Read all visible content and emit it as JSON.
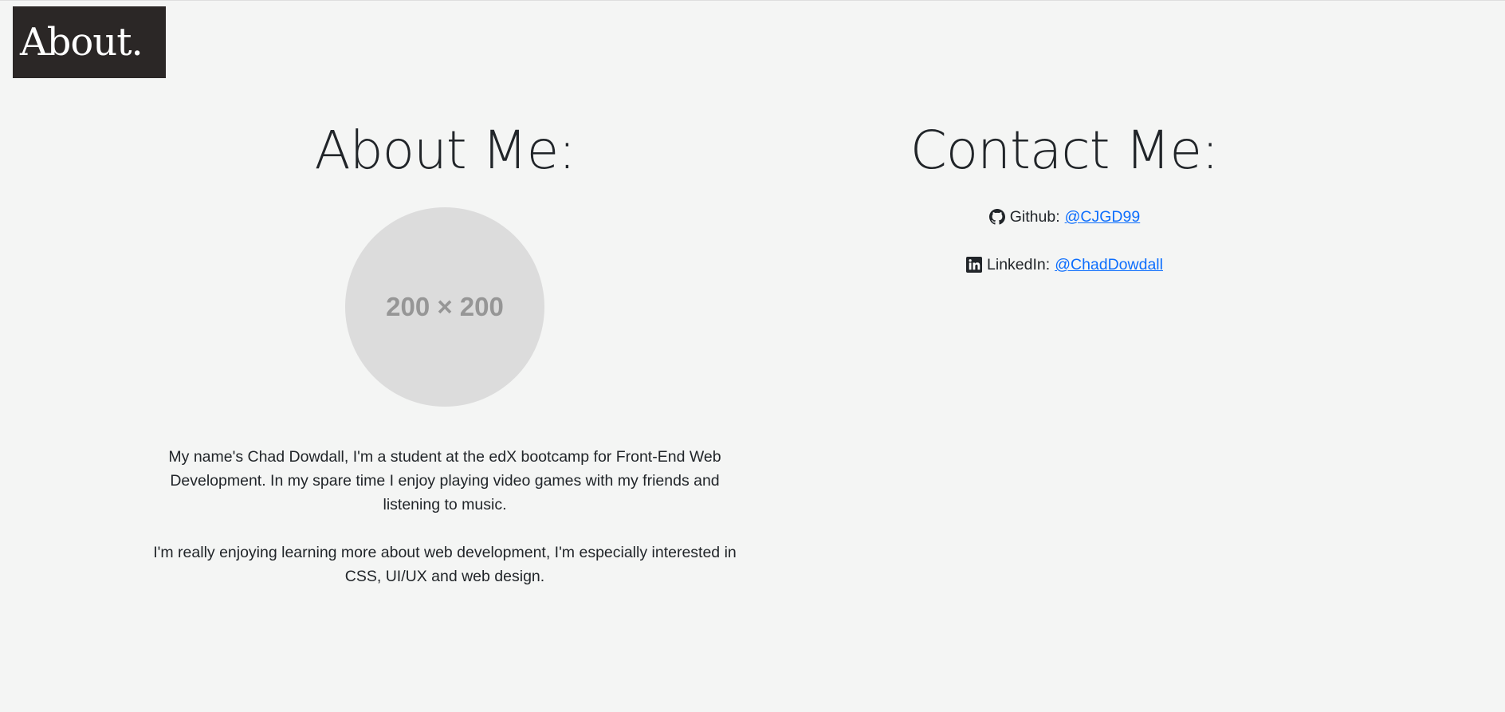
{
  "logo": {
    "text": "About."
  },
  "about": {
    "heading": "About Me:",
    "avatar_placeholder": "200 × 200",
    "bio": [
      "My name's Chad Dowdall, I'm a student at the edX bootcamp for Front-End Web Development. In my spare time I enjoy playing video games with my friends and listening to music.",
      "I'm really enjoying learning more about web development, I'm especially interested in CSS, UI/UX and web design."
    ]
  },
  "contact": {
    "heading": "Contact Me:",
    "items": [
      {
        "icon": "github-icon",
        "label": "Github:",
        "link_text": "@CJGD99"
      },
      {
        "icon": "linkedin-icon",
        "label": "LinkedIn:",
        "link_text": "@ChadDowdall"
      }
    ]
  },
  "colors": {
    "background": "#f4f5f4",
    "logo_bg": "#2b2726",
    "link": "#0d6efd",
    "avatar_bg": "#dcdcdc"
  }
}
